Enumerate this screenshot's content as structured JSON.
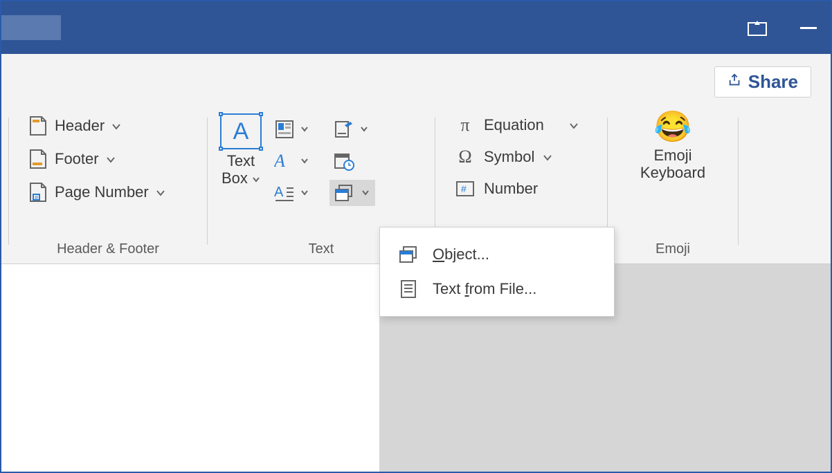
{
  "titlebar": {
    "share_label": "Share"
  },
  "ribbon": {
    "header_footer": {
      "group_label": "Header & Footer",
      "header_label": "Header",
      "footer_label": "Footer",
      "page_number_label": "Page Number"
    },
    "text": {
      "group_label": "Text",
      "text_box_line1": "Text",
      "text_box_line2": "Box"
    },
    "symbols": {
      "equation_label": "Equation",
      "symbol_label": "Symbol",
      "number_label": "Number"
    },
    "emoji": {
      "group_label": "Emoji",
      "button_line1": "Emoji",
      "button_line2": "Keyboard"
    }
  },
  "object_menu": {
    "object_prefix": "O",
    "object_rest": "bject...",
    "text_from_file_prefix_a": "Text ",
    "text_from_file_underline": "f",
    "text_from_file_suffix": "rom File..."
  }
}
